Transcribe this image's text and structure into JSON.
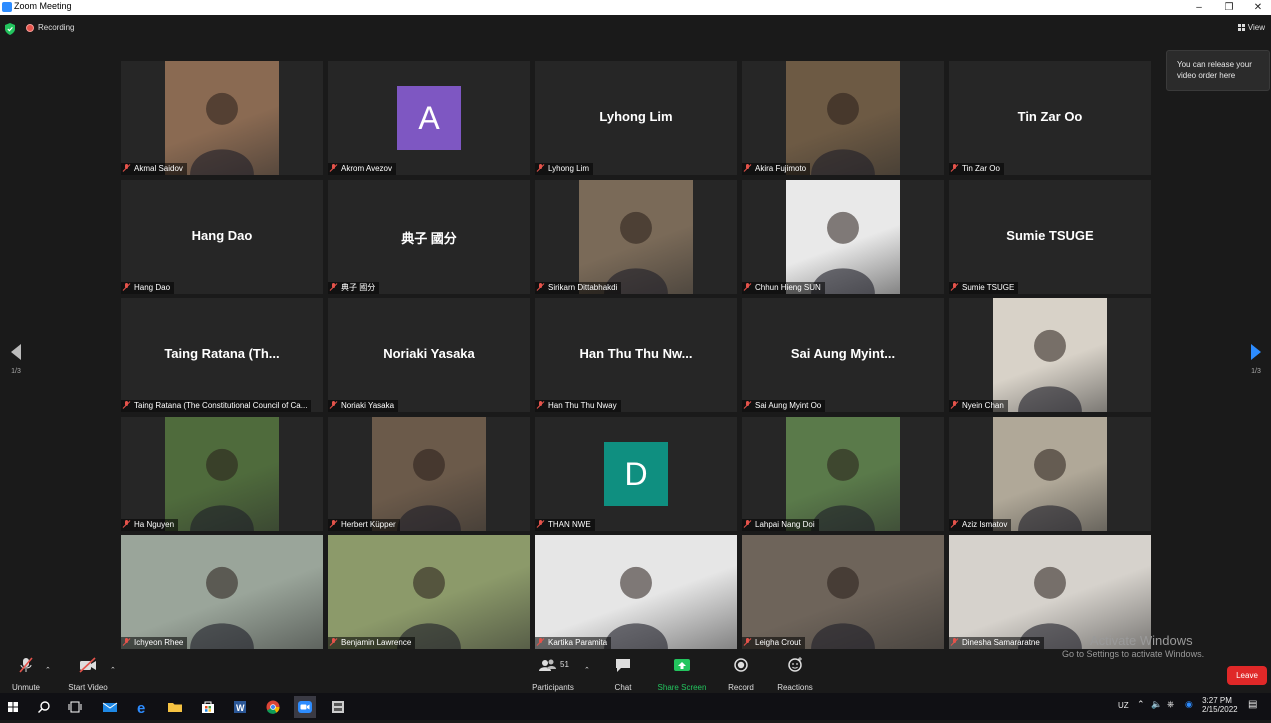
{
  "window": {
    "title": "Zoom Meeting"
  },
  "top": {
    "recording_label": "Recording",
    "view_label": "View"
  },
  "tooltip": {
    "text": "You can release your video order here"
  },
  "pager": {
    "left": "1/3",
    "right": "1/3"
  },
  "tiles": [
    {
      "name": "Akmal Saidov",
      "kind": "video",
      "bg": "#8a6a52"
    },
    {
      "name": "Akrom Avezov",
      "kind": "avatar",
      "letter": "A",
      "color": "#7e57c2"
    },
    {
      "name": "Lyhong Lim",
      "kind": "name"
    },
    {
      "name": "Akira Fujimoto",
      "kind": "video",
      "bg": "#6d5a44"
    },
    {
      "name": "Tin Zar Oo",
      "kind": "name"
    },
    {
      "name": "Hang Dao",
      "kind": "name"
    },
    {
      "name": "典子 國分",
      "kind": "name"
    },
    {
      "name": "Sirikarn Dittabhakdi",
      "kind": "video",
      "bg": "#7a6a58"
    },
    {
      "name": "Chhun Hieng SUN",
      "kind": "video",
      "bg": "#e9e9e9"
    },
    {
      "name": "Sumie TSUGE",
      "kind": "name"
    },
    {
      "name": "Taing Ratana (The Constitutional Council of Ca...",
      "big": "Taing Ratana (Th...",
      "kind": "name"
    },
    {
      "name": "Noriaki Yasaka",
      "kind": "name"
    },
    {
      "name": "Han Thu Thu Nway",
      "big": "Han Thu Thu Nw...",
      "kind": "name"
    },
    {
      "name": "Sai Aung Myint Oo",
      "big": "Sai Aung Myint...",
      "kind": "name"
    },
    {
      "name": "Nyein Chan",
      "kind": "video",
      "bg": "#d8d2c8"
    },
    {
      "name": "Ha Nguyen",
      "kind": "video",
      "bg": "#4f6b3c"
    },
    {
      "name": "Herbert Küpper",
      "kind": "video",
      "bg": "#6b5a4a"
    },
    {
      "name": "THAN NWE",
      "kind": "avatar",
      "letter": "D",
      "color": "#0f8f80"
    },
    {
      "name": "Lahpai Nang Doi",
      "kind": "video",
      "bg": "#5a7a4a"
    },
    {
      "name": "Aziz Ismatov",
      "kind": "video",
      "bg": "#b0a898"
    },
    {
      "name": "Ichyeon Rhee",
      "kind": "video",
      "bg": "#9aa59a"
    },
    {
      "name": "Benjamin Lawrence",
      "kind": "video",
      "bg": "#8c9a6a",
      "active": true
    },
    {
      "name": "Kartika Paramita",
      "kind": "video",
      "bg": "#e6e6e6"
    },
    {
      "name": "Leigha Crout",
      "kind": "video",
      "bg": "#6e645a"
    },
    {
      "name": "Dinesha Samararatne",
      "kind": "video",
      "bg": "#d6d2cc"
    }
  ],
  "toolbar": {
    "unmute": "Unmute",
    "start_video": "Start Video",
    "participants": "Participants",
    "participants_count": "51",
    "chat": "Chat",
    "share_screen": "Share Screen",
    "record": "Record",
    "reactions": "Reactions",
    "leave": "Leave"
  },
  "watermark": {
    "line1": "Activate Windows",
    "line2": "Go to Settings to activate Windows."
  },
  "taskbar": {
    "lang": "UZ",
    "time": "3:27 PM",
    "date": "2/15/2022"
  },
  "colors": {
    "accent": "#2d8cff",
    "active_border": "#c9dd6c",
    "leave": "#e02828",
    "muted": "#e5534b"
  }
}
